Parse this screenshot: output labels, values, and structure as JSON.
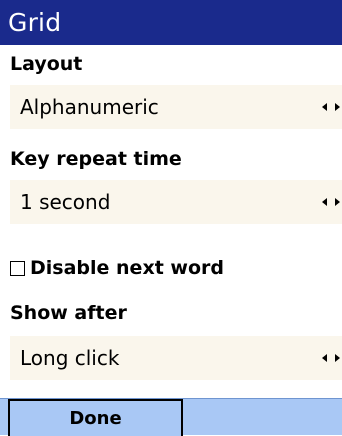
{
  "window": {
    "title": "Grid"
  },
  "settings": {
    "layout": {
      "label": "Layout",
      "value": "Alphanumeric"
    },
    "key_repeat_time": {
      "label": "Key repeat time",
      "value": "1 second"
    },
    "disable_next_word": {
      "label": "Disable next word",
      "checked": false
    },
    "show_after": {
      "label": "Show after",
      "value": "Long click"
    }
  },
  "menu_bar": {
    "left_softkey": "Done",
    "right_softkey": ""
  },
  "colors": {
    "title_bar_bg": "#1a2a8c",
    "title_text": "#ffffff",
    "picker_bg": "#faf6ec",
    "menu_bar_bg": "#a9c8f5"
  },
  "icons": {
    "picker_arrows": "left-right-arrows-icon",
    "checkbox": "checkbox-unchecked-icon"
  }
}
